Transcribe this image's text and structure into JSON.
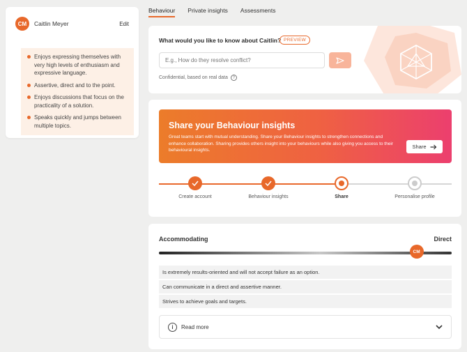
{
  "profile": {
    "initials": "CM",
    "name": "Caitlin Meyer",
    "edit_label": "Edit",
    "traits": [
      "Enjoys expressing themselves with very high levels of enthusiasm and expressive language.",
      "Assertive, direct and to the point.",
      "Enjoys discussions that focus on the practicality of a solution.",
      "Speaks quickly and jumps between multiple topics."
    ]
  },
  "tabs": [
    "Behaviour",
    "Private insights",
    "Assessments"
  ],
  "ask": {
    "title": "What would you like to know about Caitlin?",
    "badge": "PREVIEW",
    "placeholder": "E.g., How do they resolve conflict?",
    "confidential": "Confidential, based on real data"
  },
  "share": {
    "title": "Share your Behaviour insights",
    "text": "Great teams start with mutual understanding. Share your Behaviour insights to strengthen connections and enhance collaboration. Sharing provides others insight into your behaviours while also giving you access to their behavioural insights.",
    "button_label": "Share",
    "steps": [
      {
        "label": "Create account",
        "status": "done"
      },
      {
        "label": "Behaviour insights",
        "status": "done"
      },
      {
        "label": "Share",
        "status": "current"
      },
      {
        "label": "Personalise profile",
        "status": "todo"
      }
    ]
  },
  "scale": {
    "left_label": "Accommodating",
    "right_label": "Direct",
    "marker_initials": "CM",
    "position_fraction": 0.88,
    "descriptions": [
      "Is extremely results-oriented and will not accept failure as an option.",
      "Can communicate in a direct and assertive manner.",
      "Strives to achieve goals and targets."
    ],
    "read_more_label": "Read more"
  },
  "colors": {
    "accent": "#e8682a",
    "banner_start": "#ec7c2a",
    "banner_end": "#ec3f6e"
  },
  "icons": {
    "send": "send-arrow-icon",
    "info": "info-icon",
    "chevron": "chevron-down-icon",
    "check": "check-icon",
    "arrow": "arrow-right-icon"
  }
}
